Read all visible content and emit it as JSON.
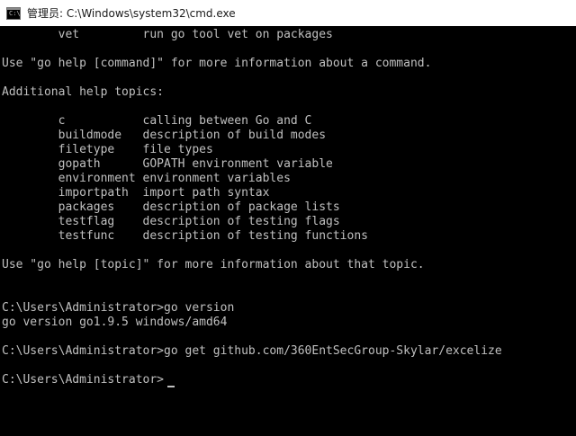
{
  "window": {
    "icon_text": "C:\\",
    "title": "管理员: C:\\Windows\\system32\\cmd.exe"
  },
  "console": {
    "lines": [
      "        vet         run go tool vet on packages",
      "",
      "Use \"go help [command]\" for more information about a command.",
      "",
      "Additional help topics:",
      "",
      "        c           calling between Go and C",
      "        buildmode   description of build modes",
      "        filetype    file types",
      "        gopath      GOPATH environment variable",
      "        environment environment variables",
      "        importpath  import path syntax",
      "        packages    description of package lists",
      "        testflag    description of testing flags",
      "        testfunc    description of testing functions",
      "",
      "Use \"go help [topic]\" for more information about that topic.",
      "",
      "",
      "C:\\Users\\Administrator>go version",
      "go version go1.9.5 windows/amd64",
      "",
      "C:\\Users\\Administrator>go get github.com/360EntSecGroup-Skylar/excelize",
      "",
      "C:\\Users\\Administrator>"
    ]
  },
  "colors": {
    "background": "#000000",
    "text": "#c0c0c0",
    "titlebar": "#ffffff"
  },
  "icons": [
    "cmd-icon"
  ]
}
